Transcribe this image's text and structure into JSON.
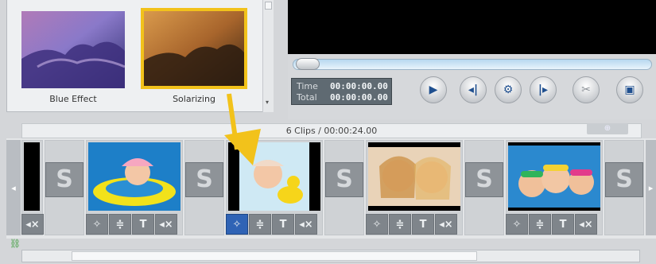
{
  "effects": {
    "items": [
      {
        "label": "Blue Effect",
        "selected": false
      },
      {
        "label": "Solarizing",
        "selected": true
      }
    ]
  },
  "player": {
    "time_label": "Time",
    "time_value": "00:00:00.00",
    "total_label": "Total",
    "total_value": "00:00:00.00"
  },
  "timeline": {
    "summary": "6 Clips / 00:00:24.00",
    "tool_labels": {
      "text": "T",
      "mute": "◂×"
    }
  },
  "colors": {
    "accent_selected": "#f2c21b",
    "button_selected": "#2f63b5"
  }
}
